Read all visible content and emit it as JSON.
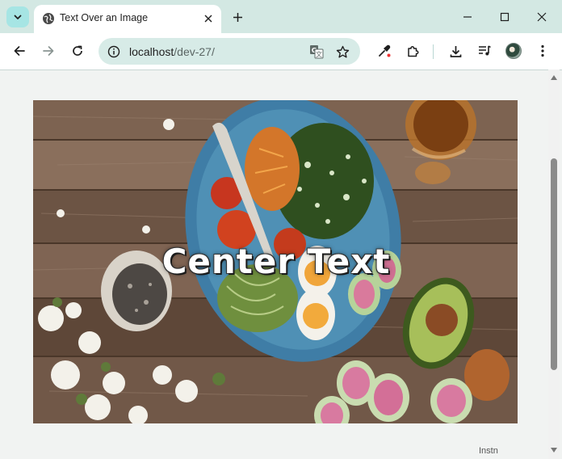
{
  "window": {
    "tab_title": "Text Over an Image",
    "url_host": "localhost",
    "url_path": "/dev-27/"
  },
  "page": {
    "overlay_text": "Center Text",
    "bottom_peek_text": "Instn"
  },
  "colors": {
    "tabstrip_bg": "#d3e8e3",
    "omnibox_bg": "#d7ebe7",
    "page_bg": "#f1f3f2",
    "overlay_text": "#ffffff"
  },
  "icons": {
    "tab_search": "chevron-down-icon",
    "favicon": "globe-icon",
    "tab_close": "close-icon",
    "new_tab": "plus-icon",
    "minimize": "minimize-icon",
    "maximize": "maximize-icon",
    "close_window": "close-icon",
    "back": "arrow-left-icon",
    "forward": "arrow-right-icon",
    "reload": "reload-icon",
    "site_info": "info-icon",
    "translate": "translate-icon",
    "bookmark": "star-icon",
    "eyedropper": "eyedropper-icon",
    "extensions": "puzzle-icon",
    "downloads": "download-icon",
    "media": "media-icon",
    "menu": "kebab-menu-icon"
  }
}
